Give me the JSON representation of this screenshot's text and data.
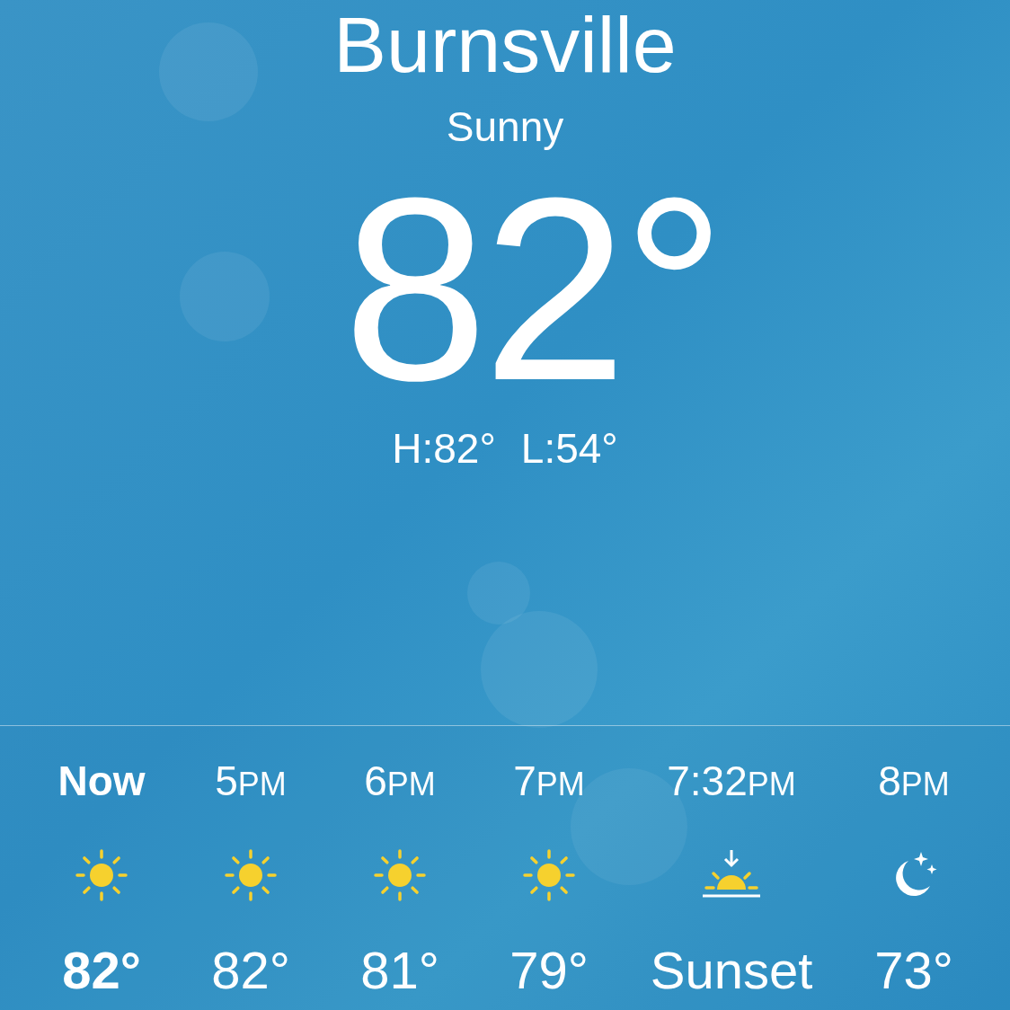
{
  "location": {
    "city": "Burnsville",
    "condition": "Sunny",
    "temperature": "82°",
    "high": "H:82°",
    "low": "L:54°"
  },
  "hourly": [
    {
      "time": "Now",
      "kind": "sun",
      "value": "82°",
      "current": true
    },
    {
      "time": "5",
      "period": "PM",
      "kind": "sun",
      "value": "82°",
      "current": false
    },
    {
      "time": "6",
      "period": "PM",
      "kind": "sun",
      "value": "81°",
      "current": false
    },
    {
      "time": "7",
      "period": "PM",
      "kind": "sun",
      "value": "79°",
      "current": false
    },
    {
      "time": "7:32",
      "period": "PM",
      "kind": "sunset",
      "value": "Sunset",
      "current": false
    },
    {
      "time": "8",
      "period": "PM",
      "kind": "moon",
      "value": "73°",
      "current": false
    }
  ]
}
